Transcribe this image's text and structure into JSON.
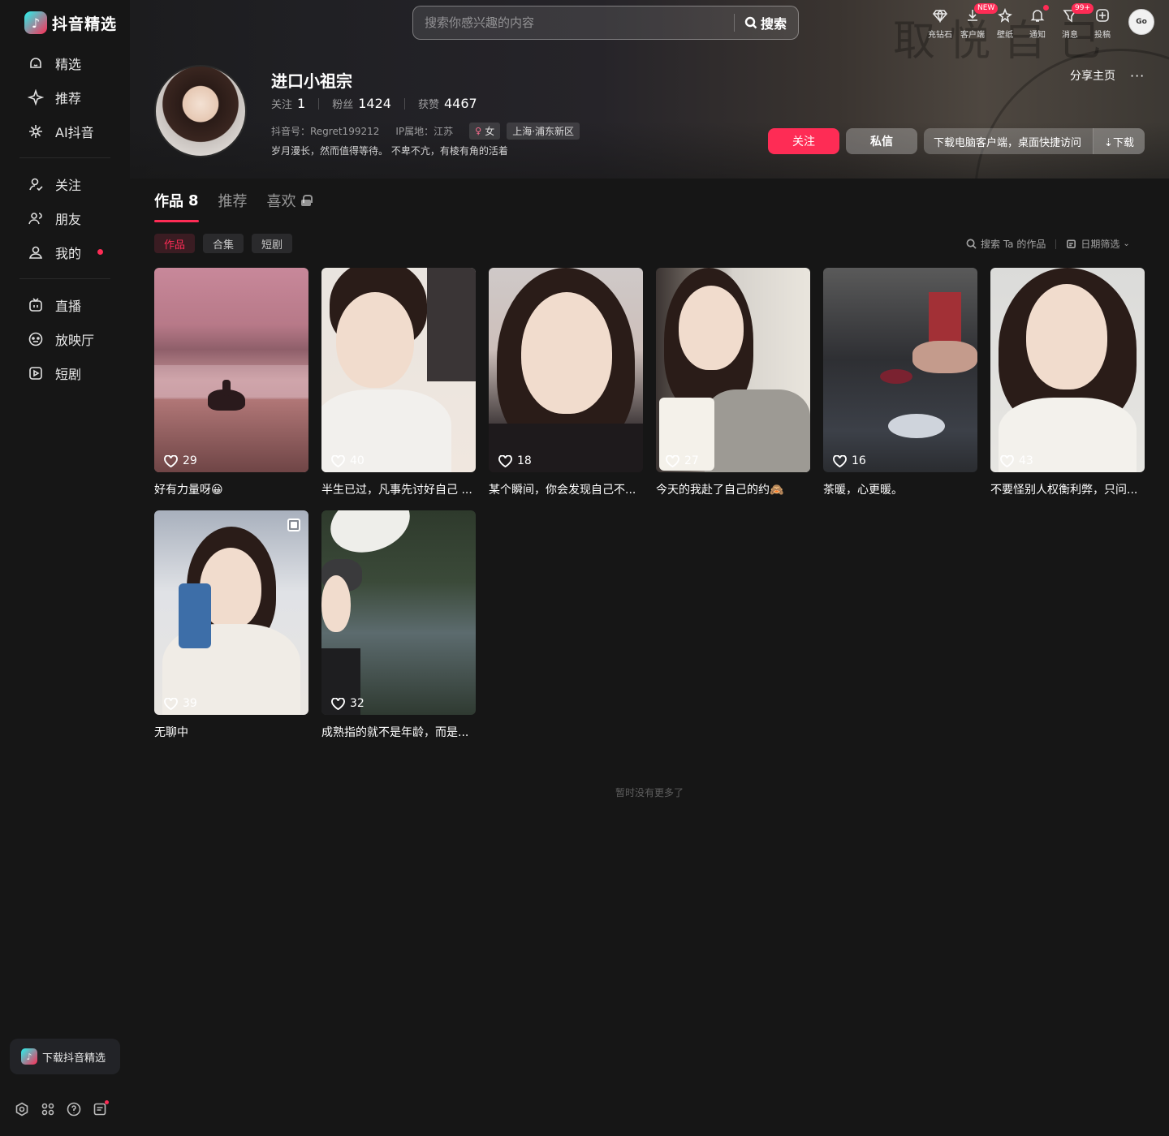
{
  "app": {
    "logo_text": "抖音精选",
    "logo_glyph": "♪"
  },
  "sidebar": {
    "group1": [
      {
        "label": "精选",
        "icon": "home-icon"
      },
      {
        "label": "推荐",
        "icon": "sparkle-icon"
      },
      {
        "label": "AI抖音",
        "icon": "ai-icon"
      }
    ],
    "group2": [
      {
        "label": "关注",
        "icon": "follow-icon"
      },
      {
        "label": "朋友",
        "icon": "friends-icon"
      },
      {
        "label": "我的",
        "icon": "user-icon",
        "has_dot": true
      }
    ],
    "group3": [
      {
        "label": "直播",
        "icon": "tv-icon"
      },
      {
        "label": "放映厅",
        "icon": "theater-icon"
      },
      {
        "label": "短剧",
        "icon": "drama-icon"
      }
    ],
    "download_label": "下载抖音精选",
    "bottom_icons": [
      "settings-icon",
      "apps-icon",
      "help-icon",
      "feedback-icon"
    ]
  },
  "header": {
    "search_placeholder": "搜索你感兴趣的内容",
    "search_button": "搜索",
    "actions": [
      {
        "label": "充钻石",
        "icon": "diamond-icon"
      },
      {
        "label": "客户端",
        "icon": "download-icon",
        "badge": "NEW"
      },
      {
        "label": "壁纸",
        "icon": "wallpaper-icon"
      },
      {
        "label": "通知",
        "icon": "bell-icon",
        "dot": true
      },
      {
        "label": "消息",
        "icon": "message-icon",
        "badge": "99+"
      },
      {
        "label": "投稿",
        "icon": "upload-icon"
      }
    ],
    "avatar_text": "Go"
  },
  "profile": {
    "name": "进口小祖宗",
    "following_label": "关注",
    "following": "1",
    "followers_label": "粉丝",
    "followers": "1424",
    "likes_label": "获赞",
    "likes": "4467",
    "douyin_id": "抖音号：Regret199212",
    "ip": "IP属地：江苏",
    "gender_tag": "女",
    "location_tag": "上海·浦东新区",
    "bio": "岁月漫长，然而值得等待。 不卑不亢，有棱有角的活着",
    "share_label": "分享主页",
    "more": "···",
    "follow_button": "关注",
    "dm_button": "私信",
    "download_text": "下载电脑客户端，桌面快捷访问",
    "download_button": "⇣下载"
  },
  "hero_decor": "取悦自己",
  "tabs": [
    {
      "label": "作品",
      "count": "8",
      "active": true
    },
    {
      "label": "推荐",
      "count": ""
    },
    {
      "label": "喜欢",
      "count": "",
      "locked": true
    }
  ],
  "subtabs": [
    {
      "label": "作品",
      "active": true
    },
    {
      "label": "合集"
    },
    {
      "label": "短剧"
    }
  ],
  "tools": {
    "search_label": "搜索 Ta 的作品",
    "date_filter": "日期筛选"
  },
  "videos": [
    {
      "likes": "29",
      "caption": "好有力量呀😀"
    },
    {
      "likes": "40",
      "caption": "半生已过，凡事先讨好自己 ..."
    },
    {
      "likes": "18",
      "caption": "某个瞬间，你会发现自己不..."
    },
    {
      "likes": "27",
      "caption": "今天的我赴了自己的约🙈"
    },
    {
      "likes": "16",
      "caption": "茶暖，心更暖。"
    },
    {
      "likes": "43",
      "caption": "不要怪别人权衡利弊，只问..."
    },
    {
      "likes": "39",
      "caption": "无聊中",
      "multi": true
    },
    {
      "likes": "32",
      "caption": "成熟指的就不是年龄，而是..."
    }
  ],
  "end_text": "暂时没有更多了",
  "colors": {
    "accent": "#fe2c55",
    "background": "#161616"
  }
}
